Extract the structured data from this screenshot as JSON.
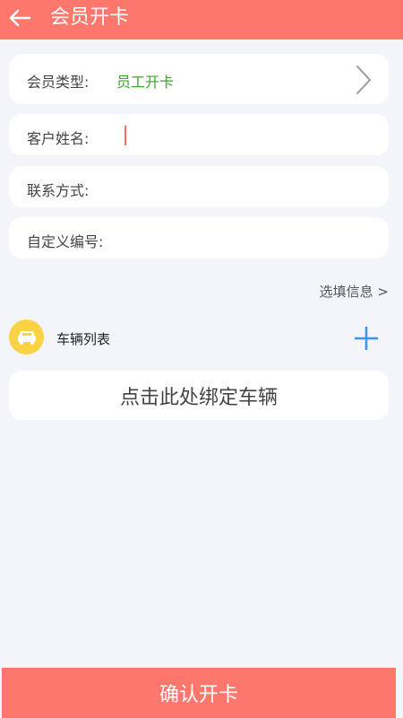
{
  "header": {
    "title": "会员开卡",
    "back_icon": "arrow-left-icon"
  },
  "form": {
    "member_type": {
      "label": "会员类型:",
      "value": "员工开卡"
    },
    "customer_name": {
      "label": "客户姓名:",
      "value": ""
    },
    "contact": {
      "label": "联系方式:",
      "value": ""
    },
    "custom_number": {
      "label": "自定义编号:",
      "value": ""
    }
  },
  "optional_info": "选填信息 >",
  "vehicles": {
    "title": "车辆列表",
    "icon": "car-icon",
    "add_icon": "plus-icon",
    "bind_prompt": "点击此处绑定车辆"
  },
  "confirm_button": "确认开卡",
  "colors": {
    "brand": "#fe776c",
    "value_green": "#3aa62c",
    "car_icon_bg": "#fcd245",
    "add_blue": "#4a90e2",
    "background": "#f3f5fa"
  }
}
